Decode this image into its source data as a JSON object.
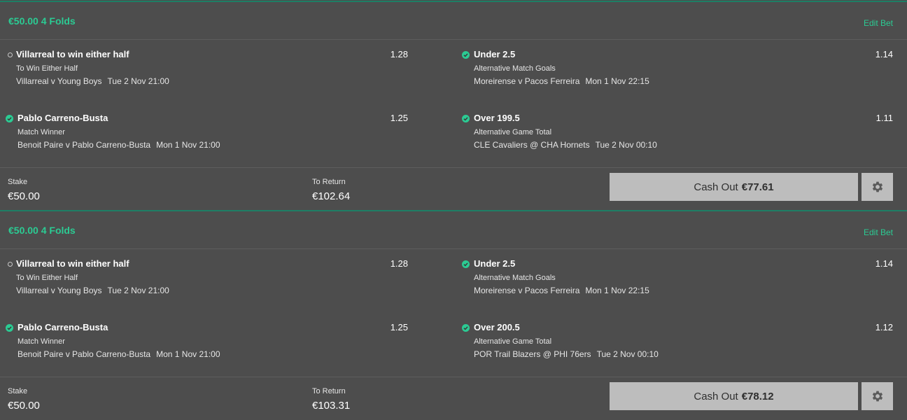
{
  "colors": {
    "background": "#4d4d4d",
    "accent": "#2bcb93",
    "divider": "#5d5d5d",
    "button": "#bdbdbd"
  },
  "bets": [
    {
      "title": "€50.00 4 Folds",
      "edit_label": "Edit Bet",
      "selections": [
        {
          "status": "open",
          "name": "Villarreal to win either half",
          "odds": "1.28",
          "market": "To Win Either Half",
          "event": "Villarreal v Young Boys",
          "time": "Tue 2 Nov 21:00"
        },
        {
          "status": "won",
          "name": "Under 2.5",
          "odds": "1.14",
          "market": "Alternative Match Goals",
          "event": "Moreirense v Pacos Ferreira",
          "time": "Mon 1 Nov 22:15"
        },
        {
          "status": "won",
          "name": "Pablo Carreno-Busta",
          "odds": "1.25",
          "market": "Match Winner",
          "event": "Benoit Paire v Pablo Carreno-Busta",
          "time": "Mon 1 Nov 21:00"
        },
        {
          "status": "won",
          "name": "Over 199.5",
          "odds": "1.11",
          "market": "Alternative Game Total",
          "event": "CLE Cavaliers @ CHA Hornets",
          "time": "Tue 2 Nov 00:10"
        }
      ],
      "stake_label": "Stake",
      "stake": "€50.00",
      "return_label": "To Return",
      "to_return": "€102.64",
      "cashout_label": "Cash Out",
      "cashout_amount": "€77.61"
    },
    {
      "title": "€50.00 4 Folds",
      "edit_label": "Edit Bet",
      "selections": [
        {
          "status": "open",
          "name": "Villarreal to win either half",
          "odds": "1.28",
          "market": "To Win Either Half",
          "event": "Villarreal v Young Boys",
          "time": "Tue 2 Nov 21:00"
        },
        {
          "status": "won",
          "name": "Under 2.5",
          "odds": "1.14",
          "market": "Alternative Match Goals",
          "event": "Moreirense v Pacos Ferreira",
          "time": "Mon 1 Nov 22:15"
        },
        {
          "status": "won",
          "name": "Pablo Carreno-Busta",
          "odds": "1.25",
          "market": "Match Winner",
          "event": "Benoit Paire v Pablo Carreno-Busta",
          "time": "Mon 1 Nov 21:00"
        },
        {
          "status": "won",
          "name": "Over 200.5",
          "odds": "1.12",
          "market": "Alternative Game Total",
          "event": "POR Trail Blazers @ PHI 76ers",
          "time": "Tue 2 Nov 00:10"
        }
      ],
      "stake_label": "Stake",
      "stake": "€50.00",
      "return_label": "To Return",
      "to_return": "€103.31",
      "cashout_label": "Cash Out",
      "cashout_amount": "€78.12"
    }
  ]
}
